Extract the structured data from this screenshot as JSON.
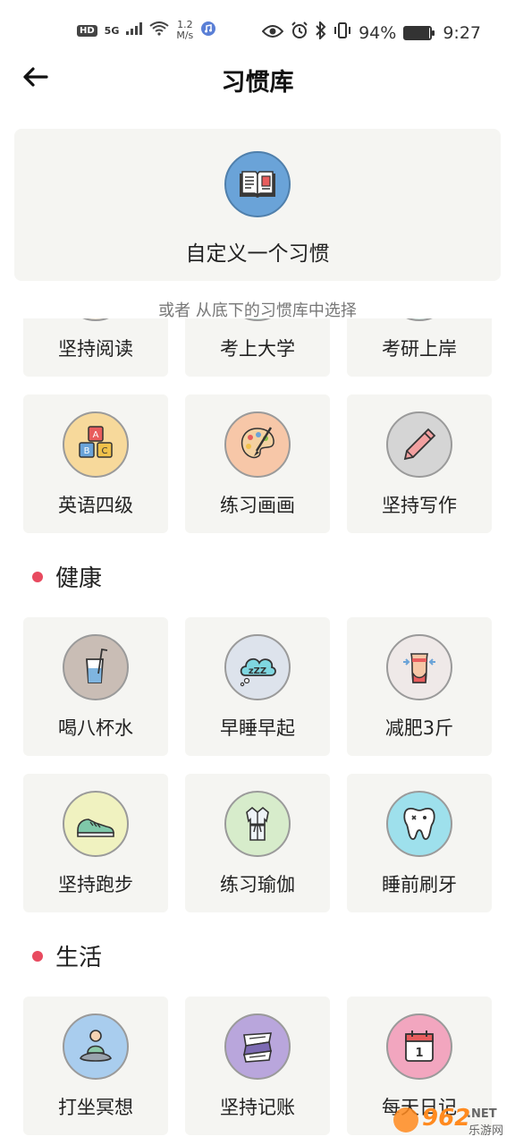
{
  "status_bar": {
    "left_badge": "HD",
    "network": "5G",
    "speed_value": "1.2",
    "speed_unit": "M/s",
    "battery": "94%",
    "battery_level": 0.94,
    "time": "9:27"
  },
  "header": {
    "title": "习惯库"
  },
  "custom": {
    "label": "自定义一个习惯"
  },
  "or_text": "或者 从底下的习惯库中选择",
  "sections": {
    "health_title": "健康",
    "life_title": "生活"
  },
  "study_tiles": {
    "row_partial": [
      "坚持阅读",
      "考上大学",
      "考研上岸"
    ],
    "row2": [
      "英语四级",
      "练习画画",
      "坚持写作"
    ]
  },
  "health_tiles": [
    "喝八杯水",
    "早睡早起",
    "减肥3斤",
    "坚持跑步",
    "练习瑜伽",
    "睡前刷牙"
  ],
  "life_tiles": [
    "打坐冥想",
    "坚持记账",
    "每天日记"
  ],
  "icons": {
    "calendar_day": "1",
    "blocks_letters": [
      "A",
      "B",
      "C"
    ]
  },
  "watermark": {
    "text": "962",
    "suffix": ".NET",
    "sub": "乐游网"
  },
  "colors": {
    "accent_dot": "#e84a5f",
    "tile_bg": "#f5f5f2"
  }
}
